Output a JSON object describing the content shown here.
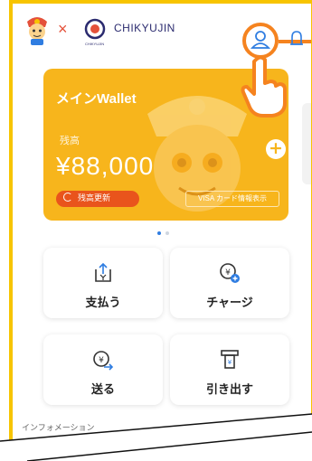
{
  "header": {
    "logo_x": "×",
    "brand_name": "CHIKYUJIN",
    "brand_sub": "CHIKYUJIN"
  },
  "wallet": {
    "title": "メインWallet",
    "balance_label": "残高",
    "balance": "¥88,000",
    "refresh_label": "残高更新",
    "visa_label": "VISA カード情報表示",
    "add_symbol": "+"
  },
  "carousel": {
    "page_count": 2,
    "active_index": 0
  },
  "actions": [
    {
      "label": "支払う"
    },
    {
      "label": "チャージ"
    },
    {
      "label": "送る"
    },
    {
      "label": "引き出す"
    }
  ],
  "info": {
    "heading": "インフォメーション"
  },
  "colors": {
    "frame": "#f7c400",
    "card": "#f7b51c",
    "accent_orange": "#f5831f",
    "refresh_red": "#e9541c",
    "icon_dark": "#333333"
  },
  "icons": [
    "mascot-logo-icon",
    "chikyujin-logo-icon",
    "profile-icon",
    "bell-icon",
    "pointing-hand-icon",
    "refresh-icon",
    "pay-icon",
    "charge-icon",
    "send-icon",
    "withdraw-icon"
  ]
}
